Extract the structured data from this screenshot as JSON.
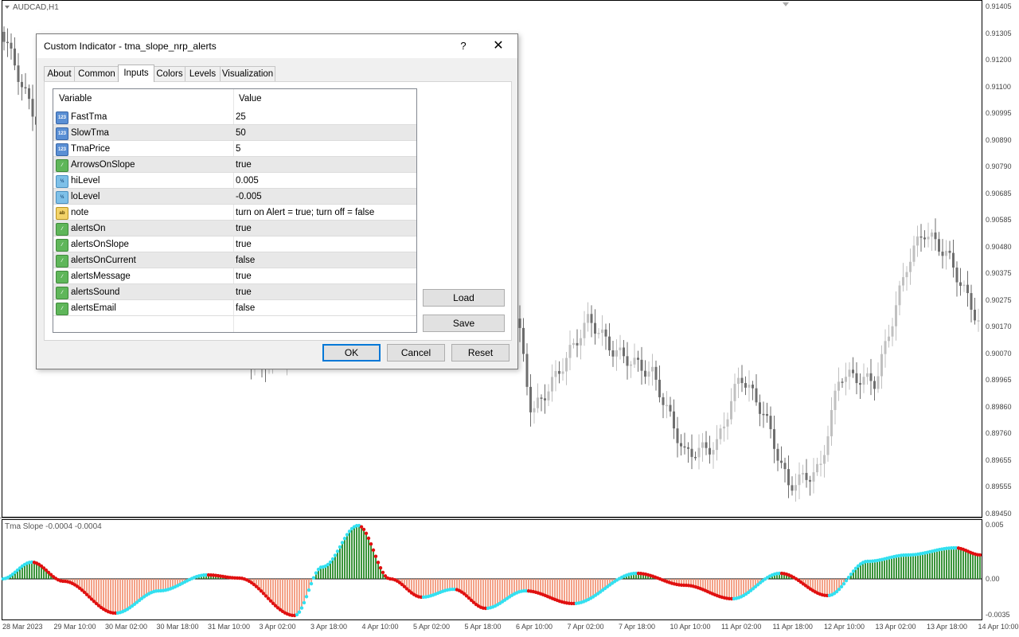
{
  "chart": {
    "symbol_title": "AUDCAD,H1",
    "indicator_title": "Tma Slope -0.0004 -0.0004",
    "price_axis": [
      "0.91405",
      "0.91305",
      "0.91200",
      "0.91100",
      "0.90995",
      "0.90890",
      "0.90790",
      "0.90685",
      "0.90585",
      "0.90480",
      "0.90375",
      "0.90275",
      "0.90170",
      "0.90070",
      "0.89965",
      "0.89860",
      "0.89760",
      "0.89655",
      "0.89555",
      "0.89450"
    ],
    "indicator_axis": [
      "0.005",
      "0.00",
      "-0.0035"
    ],
    "time_axis": [
      "28 Mar 2023",
      "29 Mar 10:00",
      "30 Mar 02:00",
      "30 Mar 18:00",
      "31 Mar 10:00",
      "3 Apr 02:00",
      "3 Apr 18:00",
      "4 Apr 10:00",
      "5 Apr 02:00",
      "5 Apr 18:00",
      "6 Apr 10:00",
      "7 Apr 02:00",
      "7 Apr 18:00",
      "10 Apr 10:00",
      "11 Apr 02:00",
      "11 Apr 18:00",
      "12 Apr 10:00",
      "13 Apr 02:00",
      "13 Apr 18:00",
      "14 Apr 10:00"
    ],
    "colors": {
      "candle_up": "#c0c0c0",
      "candle_down": "#6e6e6e",
      "hist_up": "#0a7a0a",
      "hist_down": "#f28a6a",
      "dot_up": "#33e0f0",
      "dot_down": "#e01010",
      "zero_line": "#000000"
    }
  },
  "dialog": {
    "title": "Custom Indicator - tma_slope_nrp_alerts",
    "help": "?",
    "close": "✕",
    "tabs": [
      "About",
      "Common",
      "Inputs",
      "Colors",
      "Levels",
      "Visualization"
    ],
    "active_tab": "Inputs",
    "grid": {
      "header_variable": "Variable",
      "header_value": "Value",
      "rows": [
        {
          "icon": "int",
          "name": "FastTma",
          "value": "25"
        },
        {
          "icon": "int",
          "name": "SlowTma",
          "value": "50"
        },
        {
          "icon": "int",
          "name": "TmaPrice",
          "value": "5"
        },
        {
          "icon": "bool",
          "name": "ArrowsOnSlope",
          "value": "true"
        },
        {
          "icon": "dbl",
          "name": "hiLevel",
          "value": "0.005"
        },
        {
          "icon": "dbl",
          "name": "loLevel",
          "value": "-0.005"
        },
        {
          "icon": "str",
          "name": "note",
          "value": "turn on Alert = true; turn off = false"
        },
        {
          "icon": "bool",
          "name": "alertsOn",
          "value": "true"
        },
        {
          "icon": "bool",
          "name": "alertsOnSlope",
          "value": "true"
        },
        {
          "icon": "bool",
          "name": "alertsOnCurrent",
          "value": "false"
        },
        {
          "icon": "bool",
          "name": "alertsMessage",
          "value": "true"
        },
        {
          "icon": "bool",
          "name": "alertsSound",
          "value": "true"
        },
        {
          "icon": "bool",
          "name": "alertsEmail",
          "value": "false"
        }
      ]
    },
    "icon_glyphs": {
      "int": "123",
      "bool": "⁄",
      "dbl": "½",
      "str": "ab"
    },
    "buttons": {
      "load": "Load",
      "save": "Save",
      "ok": "OK",
      "cancel": "Cancel",
      "reset": "Reset"
    }
  }
}
